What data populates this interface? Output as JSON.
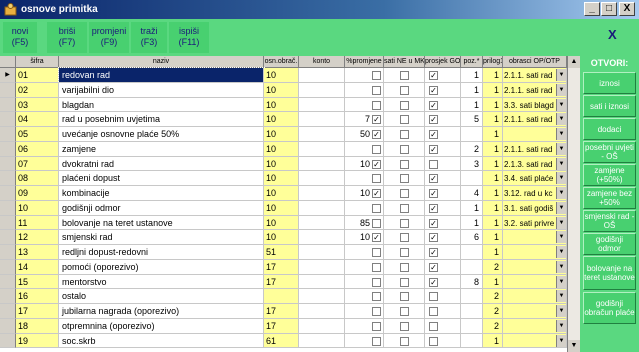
{
  "window": {
    "title": "osnove primitka",
    "buttons": [
      "_",
      "□",
      "X"
    ]
  },
  "toolbar": [
    {
      "label": "novi",
      "key": "(F5)"
    },
    {
      "label": "briši",
      "key": "(F7)"
    },
    {
      "label": "promjeni",
      "key": "(F9)"
    },
    {
      "label": "traži",
      "key": "(F3)"
    },
    {
      "label": "ispiši",
      "key": "(F11)"
    }
  ],
  "close_label": "X",
  "columns": [
    "šifra",
    "naziv",
    "osn.obrač.",
    "konto",
    "%promjene",
    "sati NE u MK",
    "prosjek GO",
    "poz.*",
    "prilog1",
    "obrasci OP/OTP"
  ],
  "rows": [
    {
      "sifra": "01",
      "naziv": "redovan rad",
      "osn": "10",
      "pct": "",
      "pct_check": false,
      "sati_ne": false,
      "prosjek": true,
      "poz": "1",
      "prilog": "1",
      "obrasci": "2.1.1. sati rad"
    },
    {
      "sifra": "02",
      "naziv": "varijabilni dio",
      "osn": "10",
      "pct": "",
      "pct_check": false,
      "sati_ne": false,
      "prosjek": true,
      "poz": "1",
      "prilog": "1",
      "obrasci": "2.1.1. sati rad"
    },
    {
      "sifra": "03",
      "naziv": "blagdan",
      "osn": "10",
      "pct": "",
      "pct_check": false,
      "sati_ne": false,
      "prosjek": true,
      "poz": "1",
      "prilog": "1",
      "obrasci": "3.3. sati blagd"
    },
    {
      "sifra": "04",
      "naziv": "rad u posebnim uvjetima",
      "osn": "10",
      "pct": "7",
      "pct_check": true,
      "sati_ne": false,
      "prosjek": true,
      "poz": "5",
      "prilog": "1",
      "obrasci": "2.1.1. sati rad"
    },
    {
      "sifra": "05",
      "naziv": "uvećanje osnovne plaće 50%",
      "osn": "10",
      "pct": "50",
      "pct_check": true,
      "sati_ne": false,
      "prosjek": true,
      "poz": "",
      "prilog": "1",
      "obrasci": ""
    },
    {
      "sifra": "06",
      "naziv": "zamjene",
      "osn": "10",
      "pct": "",
      "pct_check": false,
      "sati_ne": false,
      "prosjek": true,
      "poz": "2",
      "prilog": "1",
      "obrasci": "2.1.1. sati rad"
    },
    {
      "sifra": "07",
      "naziv": "dvokratni rad",
      "osn": "10",
      "pct": "10",
      "pct_check": true,
      "sati_ne": false,
      "prosjek": false,
      "poz": "3",
      "prilog": "1",
      "obrasci": "2.1.3. sati rad"
    },
    {
      "sifra": "08",
      "naziv": "plaćeni dopust",
      "osn": "10",
      "pct": "",
      "pct_check": false,
      "sati_ne": false,
      "prosjek": true,
      "poz": "",
      "prilog": "1",
      "obrasci": "3.4. sati plaće"
    },
    {
      "sifra": "09",
      "naziv": "kombinacije",
      "osn": "10",
      "pct": "10",
      "pct_check": true,
      "sati_ne": false,
      "prosjek": true,
      "poz": "4",
      "prilog": "1",
      "obrasci": "3.12. rad u kc"
    },
    {
      "sifra": "10",
      "naziv": "godišnji odmor",
      "osn": "10",
      "pct": "",
      "pct_check": false,
      "sati_ne": false,
      "prosjek": true,
      "poz": "1",
      "prilog": "1",
      "obrasci": "3.1. sati godiš"
    },
    {
      "sifra": "11",
      "naziv": "bolovanje na teret ustanove",
      "osn": "10",
      "pct": "85",
      "pct_check": false,
      "sati_ne": false,
      "prosjek": true,
      "poz": "1",
      "prilog": "1",
      "obrasci": "3.2. sati privre"
    },
    {
      "sifra": "12",
      "naziv": "smjenski rad",
      "osn": "10",
      "pct": "10",
      "pct_check": true,
      "sati_ne": false,
      "prosjek": true,
      "poz": "6",
      "prilog": "1",
      "obrasci": ""
    },
    {
      "sifra": "13",
      "naziv": "redljni dopust-redovni",
      "osn": "51",
      "pct": "",
      "pct_check": false,
      "sati_ne": false,
      "prosjek": true,
      "poz": "",
      "prilog": "1",
      "obrasci": ""
    },
    {
      "sifra": "14",
      "naziv": "pomoći (oporezivo)",
      "osn": "17",
      "pct": "",
      "pct_check": false,
      "sati_ne": false,
      "prosjek": true,
      "poz": "",
      "prilog": "2",
      "obrasci": ""
    },
    {
      "sifra": "15",
      "naziv": "mentorstvo",
      "osn": "17",
      "pct": "",
      "pct_check": false,
      "sati_ne": false,
      "prosjek": true,
      "poz": "8",
      "prilog": "1",
      "obrasci": ""
    },
    {
      "sifra": "16",
      "naziv": "ostalo",
      "osn": "",
      "pct": "",
      "pct_check": false,
      "sati_ne": false,
      "prosjek": false,
      "poz": "",
      "prilog": "2",
      "obrasci": ""
    },
    {
      "sifra": "17",
      "naziv": "jubilarna nagrada (oporezivo)",
      "osn": "17",
      "pct": "",
      "pct_check": false,
      "sati_ne": false,
      "prosjek": false,
      "poz": "",
      "prilog": "2",
      "obrasci": ""
    },
    {
      "sifra": "18",
      "naziv": "otpremnina (oporezivo)",
      "osn": "17",
      "pct": "",
      "pct_check": false,
      "sati_ne": false,
      "prosjek": false,
      "poz": "",
      "prilog": "2",
      "obrasci": ""
    },
    {
      "sifra": "19",
      "naziv": "soc.skrb",
      "osn": "61",
      "pct": "",
      "pct_check": false,
      "sati_ne": false,
      "prosjek": false,
      "poz": "",
      "prilog": "1",
      "obrasci": ""
    }
  ],
  "right_panel": {
    "title": "OTVORI:",
    "buttons": [
      "iznosi",
      "sati i iznosi",
      "dodaci",
      "posebni uvjeti - OŠ",
      "zamjene (+50%)",
      "zamjene bez +50%",
      "smjenski rad - OŠ",
      "godišnji odmor",
      "bolovanje na teret ustanove",
      "godišnji obračun plaće"
    ]
  }
}
